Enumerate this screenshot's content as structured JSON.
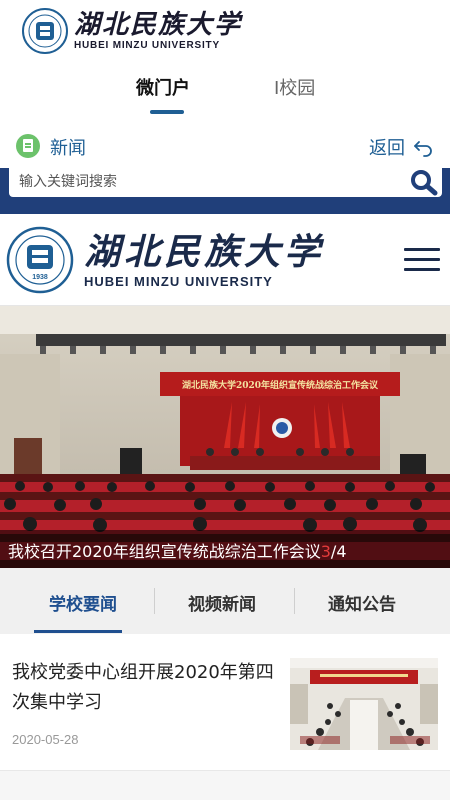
{
  "brand": {
    "name_cn": "湖北民族大学",
    "name_en": "HUBEI MINZU UNIVERSITY",
    "seal_year": "1938"
  },
  "top_tabs": [
    {
      "label": "微门户",
      "active": true
    },
    {
      "label": "I校园",
      "active": false
    }
  ],
  "news_bar": {
    "label": "新闻",
    "back_label": "返回"
  },
  "search": {
    "placeholder": "输入关键词搜索"
  },
  "slideshow": {
    "caption": "我校召开2020年组织宣传统战综治工作会议",
    "current": "3",
    "total": "/4",
    "banner_text": "湖北民族大学2020年组织宣传统战综治工作会议"
  },
  "news_tabs": [
    {
      "label": "学校要闻",
      "active": true
    },
    {
      "label": "视频新闻",
      "active": false
    },
    {
      "label": "通知公告",
      "active": false
    }
  ],
  "articles": [
    {
      "title": "我校党委中心组开展2020年第四次集中学习",
      "date": "2020-05-28"
    }
  ],
  "colors": {
    "primary": "#1f5f94",
    "search_band": "#203f7a",
    "news_icon": "#6cc26b",
    "stage_red": "#c0201e",
    "caption_highlight": "#e23b3b"
  },
  "icons": [
    "seal-icon",
    "news-icon",
    "back-arrow-icon",
    "search-icon",
    "menu-icon"
  ]
}
